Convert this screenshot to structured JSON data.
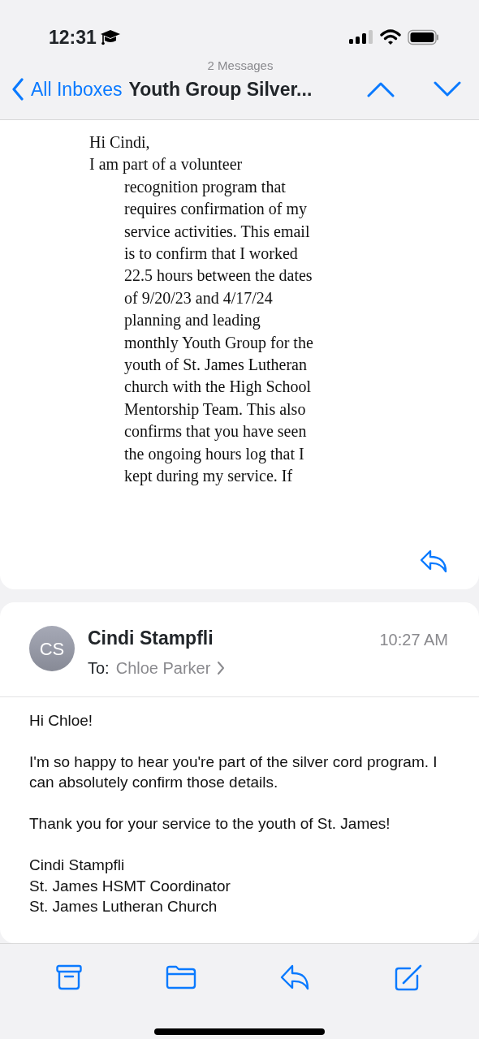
{
  "status_bar": {
    "time": "12:31"
  },
  "nav": {
    "subtitle": "2 Messages",
    "back_label": "All Inboxes",
    "title": "Youth Group Silver..."
  },
  "quoted_message": {
    "greeting": "Hi Cindi,",
    "first_line": "I am part of a volunteer",
    "lines": [
      "recognition program that",
      "requires confirmation of my",
      "service activities. This email",
      "is to confirm that I worked",
      "22.5 hours between the dates",
      "of 9/20/23 and 4/17/24",
      "planning and leading",
      "monthly Youth Group for the",
      "youth of St. James Lutheran",
      "church with the High School",
      "Mentorship Team. This also",
      "confirms that you have seen",
      "the ongoing hours log that I",
      "kept during my service. If"
    ]
  },
  "message": {
    "initials": "CS",
    "sender": "Cindi Stampfli",
    "to_label": "To:",
    "recipient": "Chloe Parker",
    "time": "10:27 AM",
    "paragraphs": [
      [
        "Hi Chloe!"
      ],
      [
        "I'm so happy to hear you're part of the silver cord program. I can absolutely confirm those details."
      ],
      [
        "Thank you for your service to the youth of St. James!"
      ],
      [
        "Cindi Stampfli",
        "St. James HSMT Coordinator",
        "St. James Lutheran Church"
      ]
    ]
  }
}
